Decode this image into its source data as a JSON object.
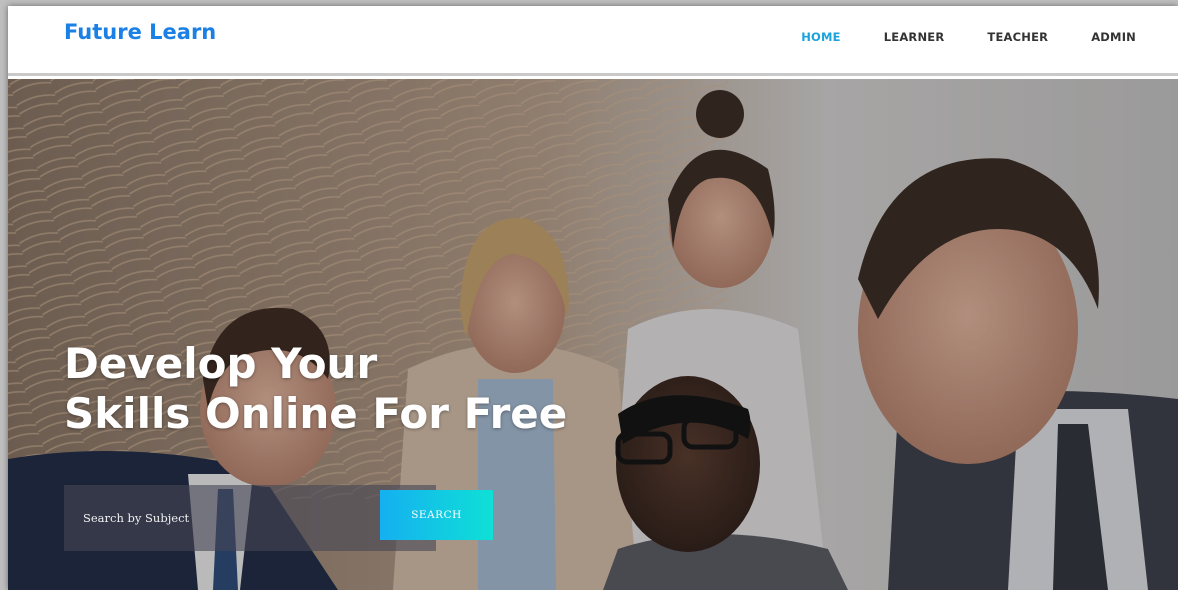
{
  "brand": {
    "name": "Future Learn",
    "color": "#1a80e5"
  },
  "nav": {
    "items": [
      {
        "label": "HOME",
        "active": true
      },
      {
        "label": "LEARNER",
        "active": false
      },
      {
        "label": "TEACHER",
        "active": false
      },
      {
        "label": "ADMIN",
        "active": false
      }
    ],
    "active_color": "#1aa3dc"
  },
  "hero": {
    "headline_line1": "Develop Your",
    "headline_line2": "Skills Online For Free",
    "image": "group-of-smiling-professionals-at-laptop"
  },
  "search": {
    "placeholder": "Search by Subject",
    "value": "",
    "button_label": "SEARCH",
    "button_gradient": [
      "#15b0f0",
      "#0fe0d6"
    ]
  }
}
